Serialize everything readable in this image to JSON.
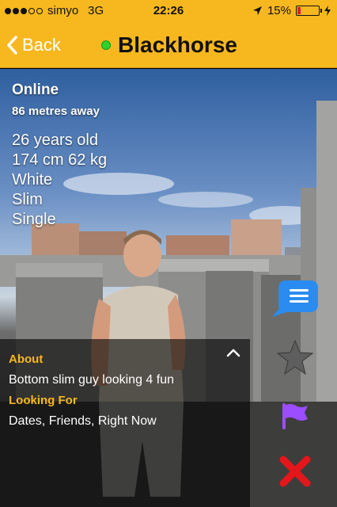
{
  "status_bar": {
    "carrier": "simyo",
    "network": "3G",
    "time": "22:26",
    "battery_percent": "15%",
    "battery_level": 0.15
  },
  "navbar": {
    "back_label": "Back",
    "title": "Blackhorse",
    "online_color": "#2fd12f"
  },
  "profile": {
    "status": "Online",
    "distance": "86 metres away",
    "stats": [
      "26 years old",
      "174 cm 62 kg",
      "White",
      "Slim",
      "Single"
    ]
  },
  "about": {
    "about_heading": "About",
    "about_text": "Bottom slim guy looking 4 fun",
    "looking_heading": "Looking For",
    "looking_text": "Dates, Friends, Right Now"
  },
  "actions": {
    "chat_icon": "chat-bubble-icon",
    "favorite_icon": "star-icon",
    "flag_icon": "flag-icon",
    "block_icon": "close-icon"
  },
  "colors": {
    "accent": "#f7b81f",
    "chat": "#2a8cf0",
    "flag": "#9b4dff",
    "block": "#e3161b"
  }
}
